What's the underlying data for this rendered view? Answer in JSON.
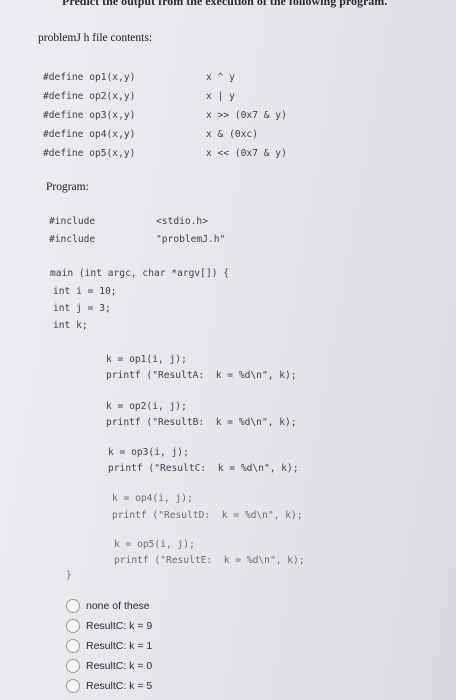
{
  "header": {
    "question": "Predict the output from the execution of the following program."
  },
  "defines": {
    "label": "problemJ h file contents:",
    "rows": [
      {
        "left": "#define op1(x,y)",
        "right": "x ^ y"
      },
      {
        "left": "#define op2(x,y)",
        "right": "x | y"
      },
      {
        "left": "#define op3(x,y)",
        "right": "x >> (0x7 & y)"
      },
      {
        "left": "#define op4(x,y)",
        "right": "x & (0xc)"
      },
      {
        "left": "#define op5(x,y)",
        "right": "x << (0x7 & y)"
      }
    ]
  },
  "program": {
    "label": "Program:",
    "includes": [
      {
        "kw": "#include",
        "file": "<stdio.h>"
      },
      {
        "kw": "#include",
        "file": "\"problemJ.h\""
      }
    ],
    "main_sig": "main (int argc, char *argv[]) {",
    "decls": [
      "int i = 10;",
      "int j = 3;",
      "int k;"
    ],
    "blocks": [
      {
        "assign": "k = op1(i, j);",
        "print": "printf (\"ResultA:  k = %d\\n\", k);"
      },
      {
        "assign": "k = op2(i, j);",
        "print": "printf (\"ResultB:  k = %d\\n\", k);"
      },
      {
        "assign": "k = op3(i, j);",
        "print": "printf (\"ResultC:  k = %d\\n\", k);"
      },
      {
        "assign": "k = op4(i, j);",
        "print": "printf (\"ResultD:  k = %d\\n\", k);"
      },
      {
        "assign": "k = op5(i, j);",
        "print": "printf (\"ResultE:  k = %d\\n\", k);"
      }
    ],
    "close": "}"
  },
  "options": [
    "none of these",
    "ResultC: k = 9",
    "ResultC: k = 1",
    "ResultC: k = 0",
    "ResultC: k = 5"
  ]
}
